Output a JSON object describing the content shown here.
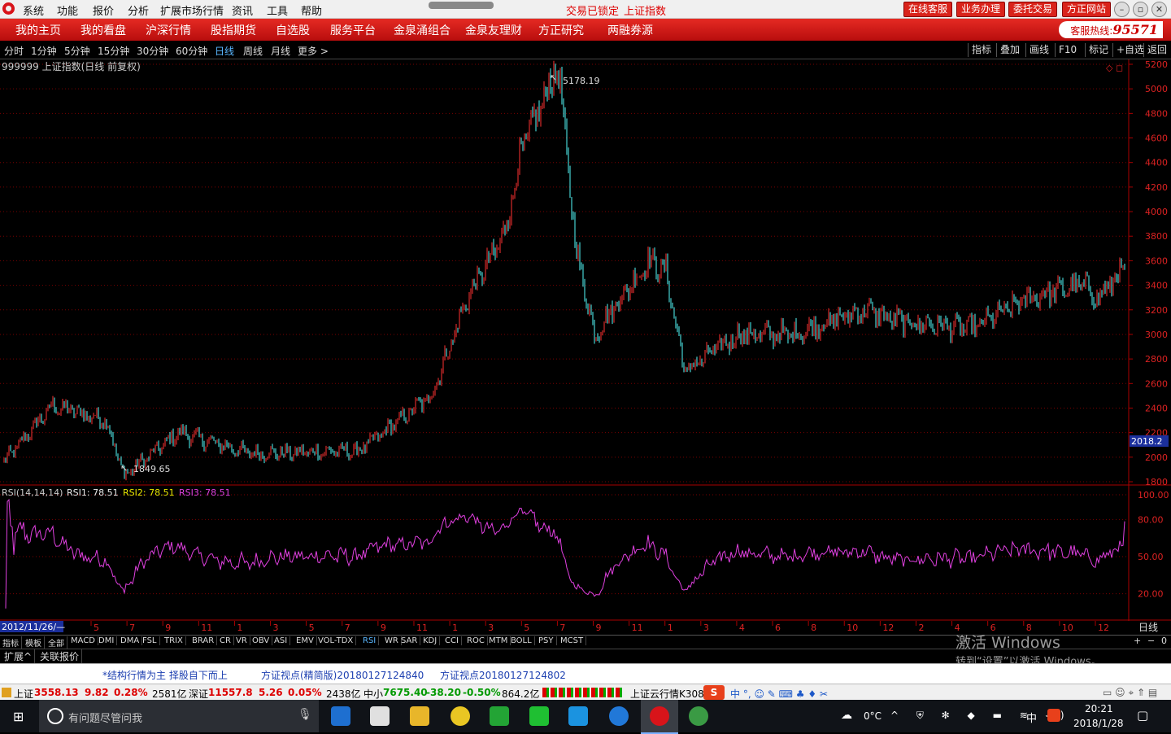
{
  "menubar": {
    "items": [
      "系统",
      "功能",
      "报价",
      "分析",
      "扩展市场行情",
      "资讯",
      "工具",
      "帮助"
    ],
    "status_left": "交易已锁定",
    "status_right": "上证指数",
    "buttons": [
      "在线客服",
      "业务办理",
      "委托交易",
      "方正网站"
    ]
  },
  "navbar": {
    "items": [
      "我的主页",
      "我的看盘",
      "沪深行情",
      "股指期货",
      "自选股",
      "服务平台",
      "金泉涌组合",
      "金泉友理财",
      "方正研究",
      "两融券源"
    ],
    "hotline_label": "客服热线:",
    "hotline_number": "95571"
  },
  "periodbar": {
    "periods": [
      "分时",
      "1分钟",
      "5分钟",
      "15分钟",
      "30分钟",
      "60分钟",
      "日线",
      "周线",
      "月线",
      "更多 >"
    ],
    "active": "日线",
    "right_buttons": [
      "指标",
      "叠加",
      "画线",
      "F10",
      "标记",
      "+自选",
      "返回"
    ]
  },
  "chart_data": [
    {
      "type": "candlestick",
      "title": "999999 上证指数(日线 前复权)",
      "ylim": [
        1700,
        5300
      ],
      "yticks": [
        1800,
        2000,
        2200,
        2400,
        2600,
        2800,
        3000,
        3200,
        3400,
        3600,
        3800,
        4000,
        4200,
        4400,
        4600,
        4800,
        5000,
        5200
      ],
      "annotations": [
        {
          "label": "5178.19",
          "value": 5178.19
        },
        {
          "label": "1849.65",
          "value": 1849.65
        }
      ],
      "current_label": "2018.2",
      "close_trend": [
        [
          "2012-11-26",
          1960
        ],
        [
          "2013-02",
          2420
        ],
        [
          "2013-05",
          2300
        ],
        [
          "2013-06",
          1849.65
        ],
        [
          "2013-09",
          2200
        ],
        [
          "2014-01",
          2030
        ],
        [
          "2014-07",
          2050
        ],
        [
          "2014-11",
          2500
        ],
        [
          "2015-01",
          3300
        ],
        [
          "2015-03",
          3800
        ],
        [
          "2015-04",
          4500
        ],
        [
          "2015-06",
          5178.19
        ],
        [
          "2015-07",
          3700
        ],
        [
          "2015-08",
          3000
        ],
        [
          "2015-11",
          3600
        ],
        [
          "2015-12",
          3500
        ],
        [
          "2016-01",
          2700
        ],
        [
          "2016-04",
          3000
        ],
        [
          "2016-07",
          3000
        ],
        [
          "2016-11",
          3200
        ],
        [
          "2017-01",
          3100
        ],
        [
          "2017-05",
          3050
        ],
        [
          "2017-08",
          3300
        ],
        [
          "2017-11",
          3400
        ],
        [
          "2017-12",
          3300
        ],
        [
          "2018-01-26",
          3558.13
        ]
      ]
    },
    {
      "type": "line",
      "title": "RSI(14,14,14)",
      "series": [
        {
          "name": "RSI1",
          "value": 78.51
        },
        {
          "name": "RSI2",
          "value": 78.51
        },
        {
          "name": "RSI3",
          "value": 78.51
        }
      ],
      "ylim": [
        0,
        100
      ],
      "yticks_labels": [
        "100.00",
        "80.00",
        "50.00",
        "20.00"
      ],
      "yticks": [
        100,
        80,
        50,
        20
      ]
    }
  ],
  "rsi_labels": {
    "title": "RSI(14,14,14)",
    "r1": "RSI1: 78.51",
    "r2": "RSI2: 78.51",
    "r3": "RSI3: 78.51"
  },
  "xaxis": {
    "start_date": "2012/11/26/—",
    "months": [
      "5",
      "7",
      "9",
      "11",
      "1",
      "3",
      "5",
      "7",
      "9",
      "11",
      "1",
      "3",
      "5",
      "7",
      "9",
      "11",
      "1",
      "3",
      "4",
      "6",
      "8",
      "10",
      "12",
      "2",
      "4",
      "6",
      "8",
      "10",
      "12"
    ],
    "period_label": "日线"
  },
  "indicator_tabs": [
    "指标",
    "模板",
    "全部",
    "MACD",
    "DMI",
    "DMA",
    "FSL",
    "TRIX",
    "BRAR",
    "CR",
    "VR",
    "OBV",
    "ASI",
    "EMV",
    "VOL-TDX",
    "RSI",
    "WR",
    "SAR",
    "KDJ",
    "CCI",
    "ROC",
    "MTM",
    "BOLL",
    "PSY",
    "MCST"
  ],
  "indicator_active": "RSI",
  "extbar": [
    "扩展^",
    "关联报价"
  ],
  "news": [
    "*结构行情为主  择股自下而上",
    "方证视点(精简版)20180127124840",
    "方证视点20180127124802"
  ],
  "quotes": {
    "sh_label": "上证",
    "sh_value": "3558.13",
    "sh_change": "9.82",
    "sh_pct": "0.28%",
    "sh_amount": "2581亿",
    "sz_label": "深证",
    "sz_value": "11557.8",
    "sz_change": "5.26",
    "sz_pct": "0.05%",
    "sz_amount": "2438亿",
    "zx_label": "中小",
    "zx_value": "7675.40",
    "zx_change": "-38.20",
    "zx_pct": "-0.50%",
    "zx_amount": "864.2亿",
    "cloud": "上证云行情K308"
  },
  "taskbar": {
    "search_placeholder": "有问题尽管问我",
    "weather": "0°C",
    "ime": "中",
    "time": "20:21",
    "date": "2018/1/28"
  },
  "watermark": {
    "line1": "激活 Windows",
    "line2": "转到“设置”以激活 Windows。"
  }
}
